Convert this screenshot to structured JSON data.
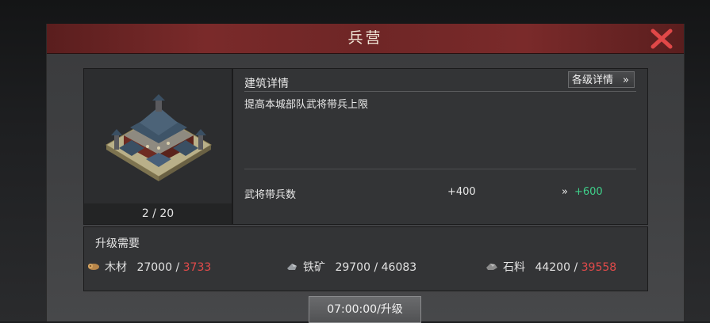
{
  "dialog": {
    "title": "兵营",
    "close_icon": "close-x-icon"
  },
  "building": {
    "image_icon": "barracks-building-image",
    "level_text": "2 / 20"
  },
  "info": {
    "title": "建筑详情",
    "detail_button": "各级详情",
    "detail_chevron": "»",
    "description": "提高本城部队武将带兵上限",
    "stat_label": "武将带兵数",
    "stat_current": "+400",
    "stat_arrow": "»",
    "stat_next": "+600"
  },
  "requirements": {
    "title": "升级需要",
    "items": [
      {
        "icon": "wood-icon",
        "name": "木材",
        "need": "27000",
        "sep": " / ",
        "have": "3733",
        "enough": false
      },
      {
        "icon": "iron-ore-icon",
        "name": "铁矿",
        "need": "29700",
        "sep": " / ",
        "have": "46083",
        "enough": true
      },
      {
        "icon": "stone-icon",
        "name": "石料",
        "need": "44200",
        "sep": " / ",
        "have": "39558",
        "enough": false
      }
    ]
  },
  "upgrade_button": "07:00:00/升级",
  "colors": {
    "title_bar": "#7a2a2a",
    "positive": "#3fcf8a",
    "insufficient": "#e24a4a",
    "close": "#e04848"
  }
}
